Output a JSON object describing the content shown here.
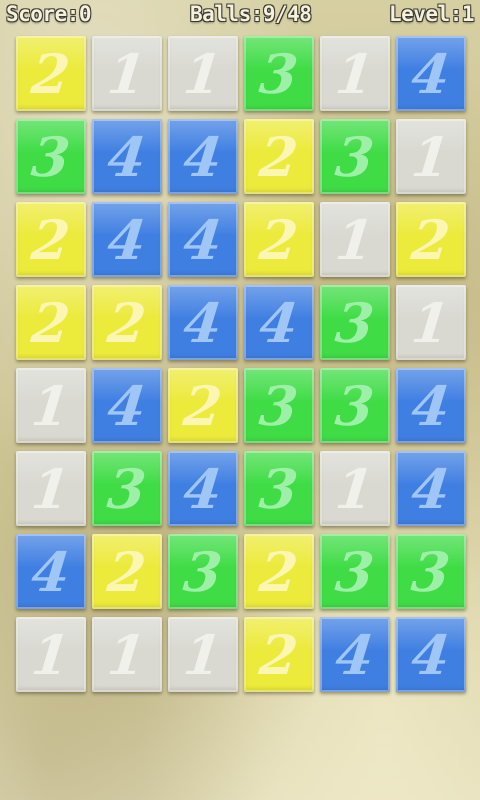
{
  "hud": {
    "score": "Score:0",
    "balls": "Balls:9/48",
    "level": "Level:1"
  },
  "colors": {
    "1": {
      "bg": "#d9d9d2",
      "num": "#f1f1ec"
    },
    "2": {
      "bg": "#ecea3a",
      "num": "#fbf7b2"
    },
    "3": {
      "bg": "#3fdc46",
      "num": "#9ef0a8"
    },
    "4": {
      "bg": "#3f7fe2",
      "num": "#9fc6f6"
    }
  },
  "board": {
    "rows": [
      [
        "2",
        "1",
        "1",
        "3",
        "1",
        "4"
      ],
      [
        "3",
        "4",
        "4",
        "2",
        "3",
        "1"
      ],
      [
        "2",
        "4",
        "4",
        "2",
        "1",
        "2"
      ],
      [
        "2",
        "2",
        "4",
        "4",
        "3",
        "1"
      ],
      [
        "1",
        "4",
        "2",
        "3",
        "3",
        "4"
      ],
      [
        "1",
        "3",
        "4",
        "3",
        "1",
        "4"
      ],
      [
        "4",
        "2",
        "3",
        "2",
        "3",
        "3"
      ],
      [
        "1",
        "1",
        "1",
        "2",
        "4",
        "4"
      ]
    ]
  }
}
